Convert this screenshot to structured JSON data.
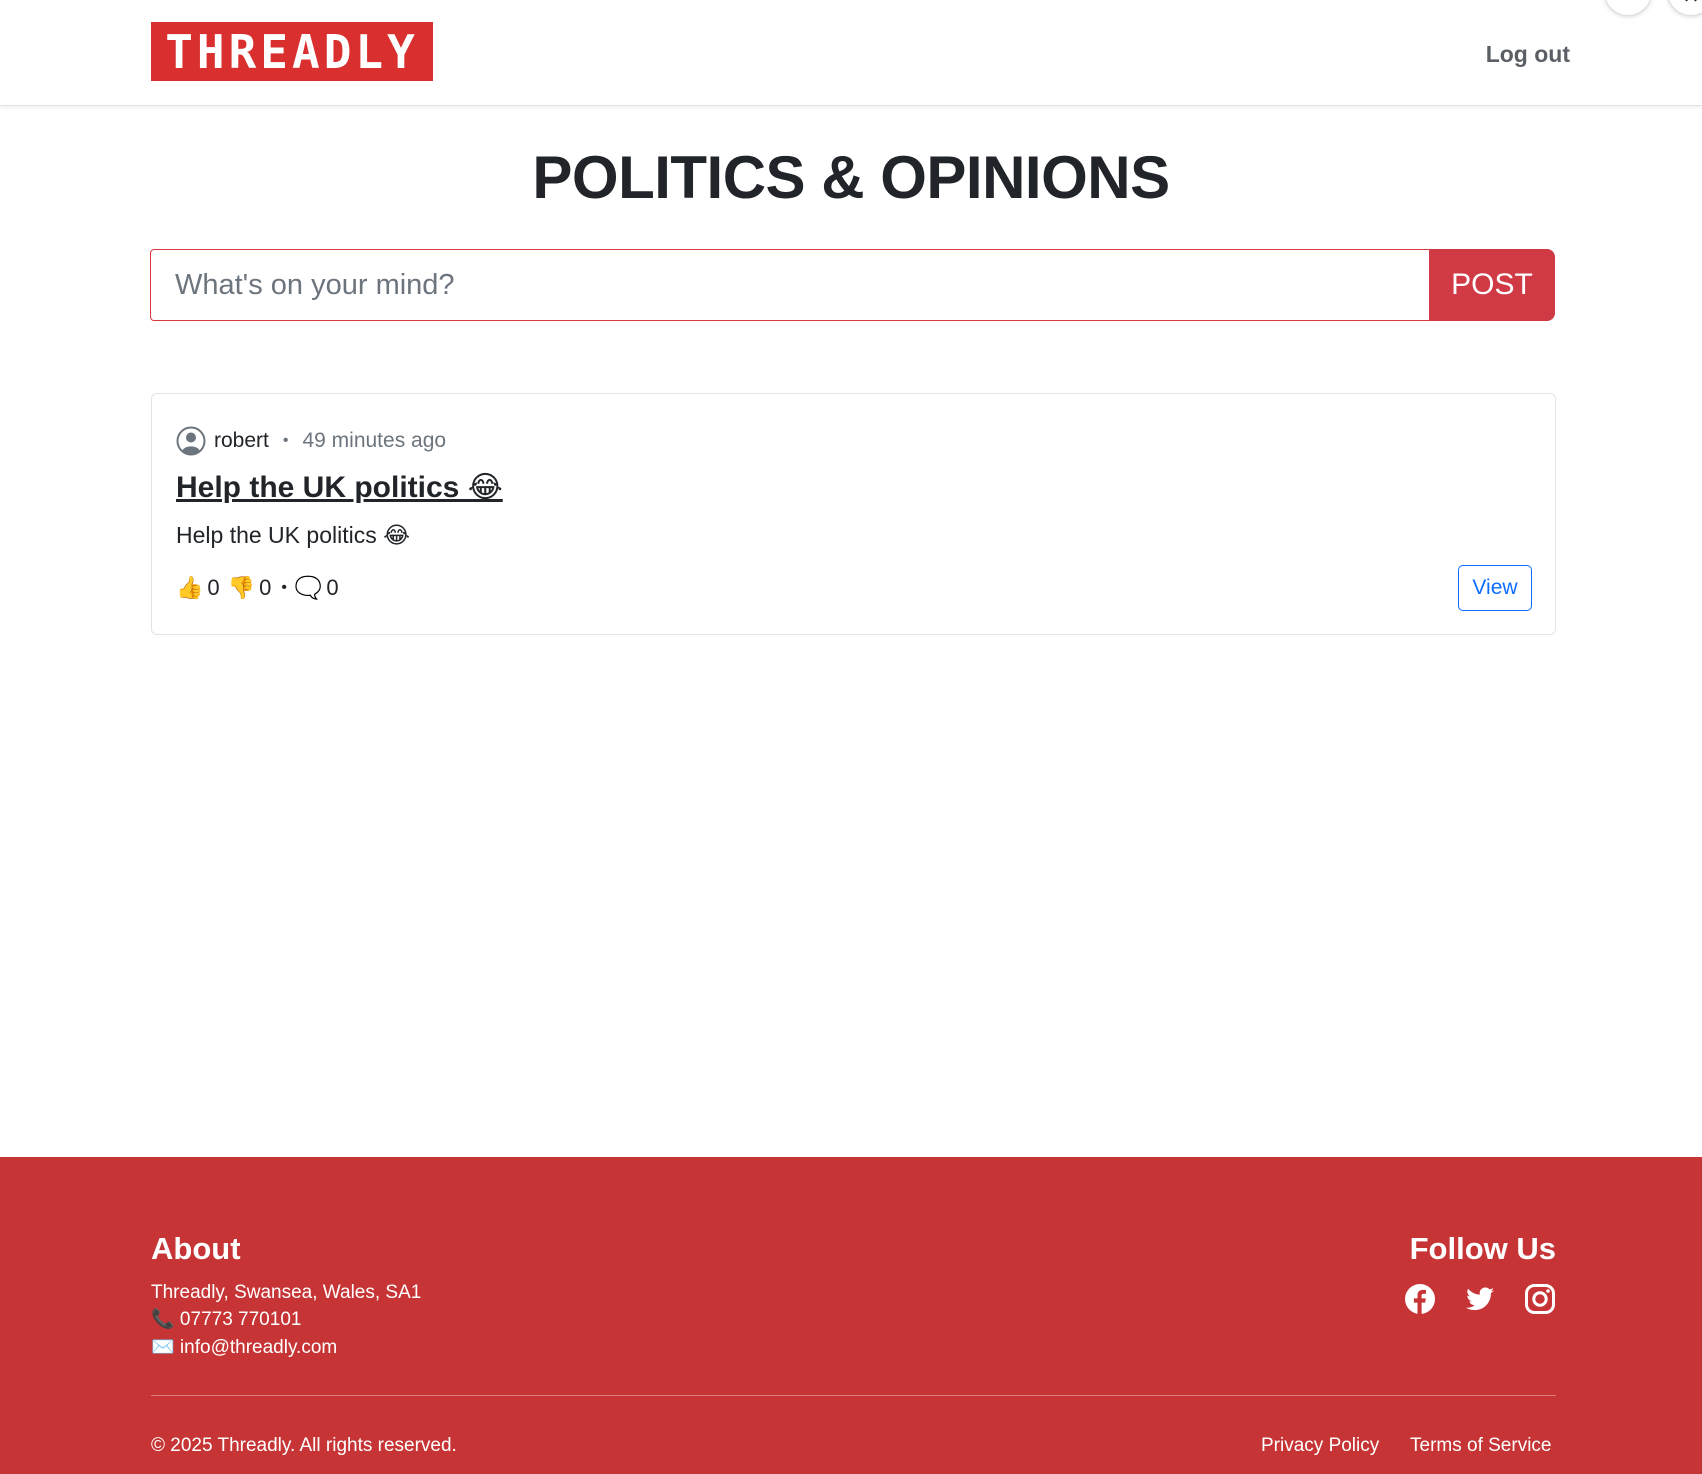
{
  "header": {
    "logo_text": "THREADLY",
    "logout_label": "Log out",
    "more_label": "···",
    "close_label": "✕"
  },
  "page": {
    "title": "POLITICS & OPINIONS"
  },
  "compose": {
    "placeholder": "What's on your mind?",
    "post_label": "POST"
  },
  "posts": [
    {
      "author": "robert",
      "separator": "•",
      "time": "49 minutes ago",
      "title": "Help the UK politics 😂",
      "body": "Help the UK politics 😂",
      "likes_icon": "👍",
      "likes": "0",
      "dislikes_icon": "👎",
      "dislikes": "0",
      "stat_separator": "•",
      "comments_icon": "🗨️",
      "comments": "0",
      "view_label": "View"
    }
  ],
  "footer": {
    "about_title": "About",
    "address": "Threadly, Swansea, Wales, SA1",
    "phone": "📞 07773 770101",
    "email": "✉️ info@threadly.com",
    "follow_title": "Follow Us",
    "social_icons": [
      "facebook-icon",
      "twitter-icon",
      "instagram-icon"
    ],
    "copyright": "© 2025 Threadly. All rights reserved.",
    "privacy_label": "Privacy Policy",
    "terms_label": "Terms of Service"
  },
  "colors": {
    "brand_red": "#d9302f",
    "footer_red": "#c73435",
    "post_button": "#cf3a44",
    "link_blue": "#0d6efd"
  }
}
